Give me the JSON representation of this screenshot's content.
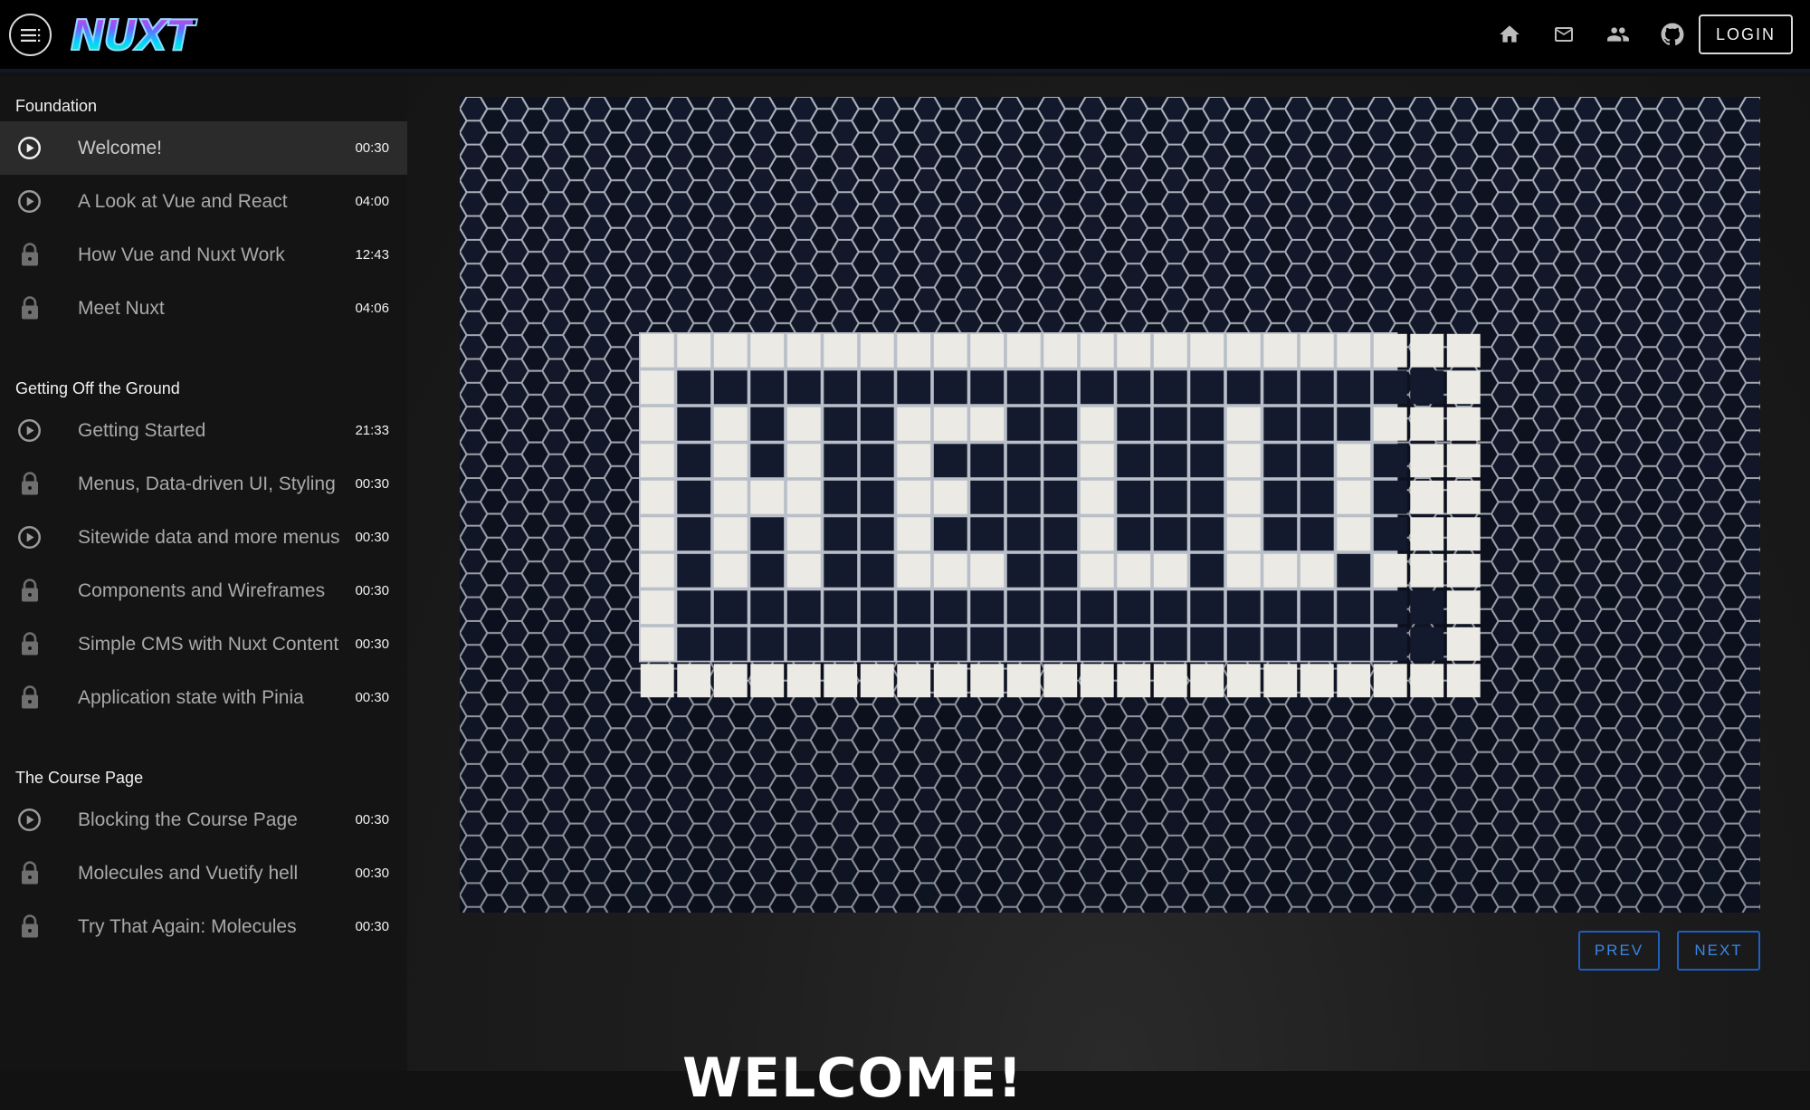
{
  "header": {
    "logo_text": "NUXT",
    "login_label": "LOGIN",
    "icons": [
      "menu-icon",
      "home-icon",
      "mail-icon",
      "people-icon",
      "github-icon"
    ]
  },
  "sidebar": {
    "sections": [
      {
        "title": "Foundation",
        "lessons": [
          {
            "title": "Welcome!",
            "time": "00:30",
            "icon": "play-icon",
            "active": true
          },
          {
            "title": "A Look at Vue and React",
            "time": "04:00",
            "icon": "play-icon"
          },
          {
            "title": "How Vue and Nuxt Work",
            "time": "12:43",
            "icon": "lock-icon"
          },
          {
            "title": "Meet Nuxt",
            "time": "04:06",
            "icon": "lock-icon"
          }
        ]
      },
      {
        "title": "Getting Off the Ground",
        "lessons": [
          {
            "title": "Getting Started",
            "time": "21:33",
            "icon": "play-icon"
          },
          {
            "title": "Menus, Data-driven UI, Styling",
            "time": "00:30",
            "icon": "lock-icon"
          },
          {
            "title": "Sitewide data and more menus",
            "time": "00:30",
            "icon": "play-icon"
          },
          {
            "title": "Components and Wireframes",
            "time": "00:30",
            "icon": "lock-icon"
          },
          {
            "title": "Simple CMS with Nuxt Content",
            "time": "00:30",
            "icon": "lock-icon"
          },
          {
            "title": "Application state with Pinia",
            "time": "00:30",
            "icon": "lock-icon"
          }
        ]
      },
      {
        "title": "The Course Page",
        "lessons": [
          {
            "title": "Blocking the Course Page",
            "time": "00:30",
            "icon": "play-icon"
          },
          {
            "title": "Molecules and Vuetify hell",
            "time": "00:30",
            "icon": "lock-icon"
          },
          {
            "title": "Try That Again: Molecules",
            "time": "00:30",
            "icon": "lock-icon"
          }
        ]
      }
    ]
  },
  "main": {
    "hero_image_word": "HELLO",
    "prev_label": "PREV",
    "next_label": "NEXT",
    "heading": "WELCOME!"
  },
  "colors": {
    "accent": "#1f5fbf",
    "header_bg": "#000000",
    "sidebar_bg": "#141414",
    "active_row": "#2b2b2b"
  }
}
